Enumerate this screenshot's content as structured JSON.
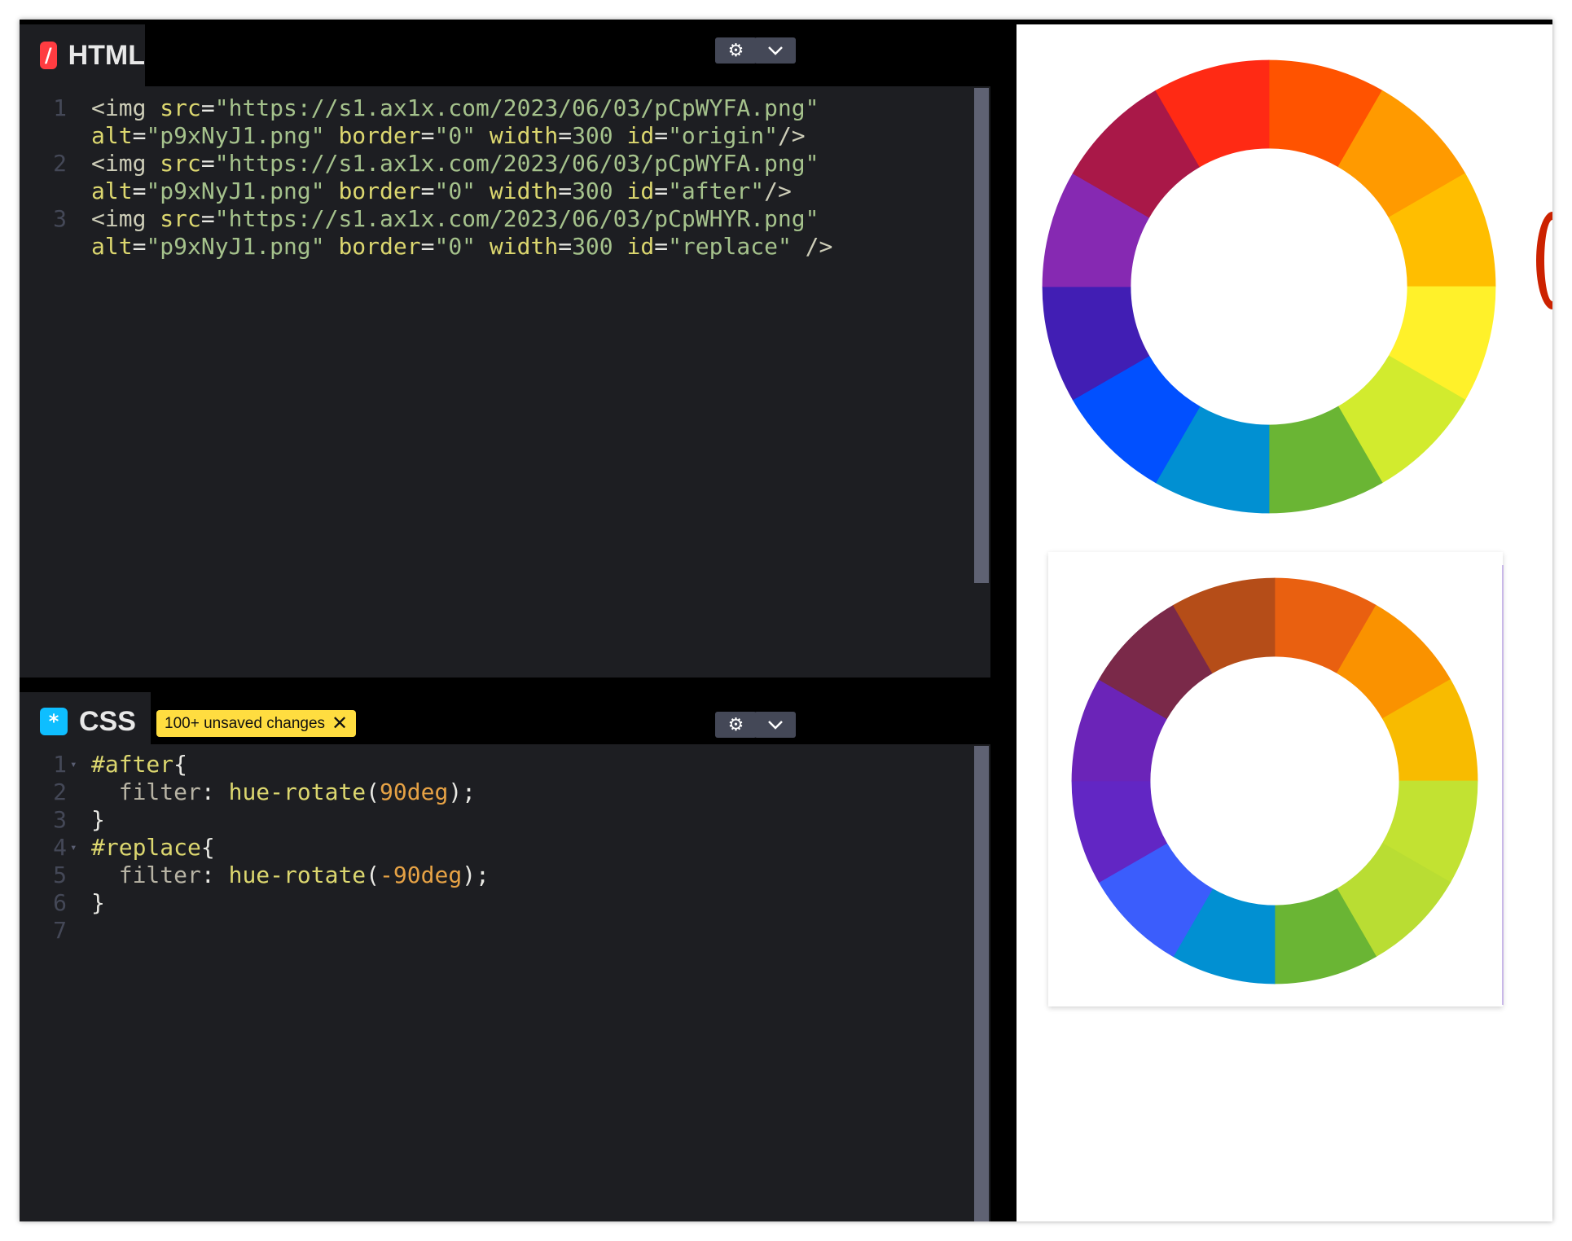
{
  "html_panel": {
    "title": "HTML",
    "icon": "codepen-html-icon",
    "icon_color": "#ff3c41",
    "settings_icon": "gear-icon",
    "collapse_icon": "chevron-down-icon",
    "lines": [
      {
        "number": "1",
        "rows": [
          [
            [
              "tag",
              "<img "
            ],
            [
              "attr",
              "src"
            ],
            [
              "pun",
              "="
            ],
            [
              "str",
              "\"https://s1.ax1x.com/2023/06/03/pCpWYFA.png\""
            ]
          ],
          [
            [
              "attr",
              "alt"
            ],
            [
              "pun",
              "="
            ],
            [
              "str",
              "\"p9xNyJ1.png\""
            ],
            [
              "pun",
              " "
            ],
            [
              "attr",
              "border"
            ],
            [
              "pun",
              "="
            ],
            [
              "str",
              "\"0\""
            ],
            [
              "pun",
              " "
            ],
            [
              "attr",
              "width"
            ],
            [
              "pun",
              "="
            ],
            [
              "str",
              "300"
            ],
            [
              "pun",
              " "
            ],
            [
              "attr",
              "id"
            ],
            [
              "pun",
              "="
            ],
            [
              "str",
              "\"origin\""
            ],
            [
              "tag",
              "/>"
            ]
          ]
        ]
      },
      {
        "number": "2",
        "rows": [
          [
            [
              "tag",
              "<img "
            ],
            [
              "attr",
              "src"
            ],
            [
              "pun",
              "="
            ],
            [
              "str",
              "\"https://s1.ax1x.com/2023/06/03/pCpWYFA.png\""
            ]
          ],
          [
            [
              "attr",
              "alt"
            ],
            [
              "pun",
              "="
            ],
            [
              "str",
              "\"p9xNyJ1.png\""
            ],
            [
              "pun",
              " "
            ],
            [
              "attr",
              "border"
            ],
            [
              "pun",
              "="
            ],
            [
              "str",
              "\"0\""
            ],
            [
              "pun",
              " "
            ],
            [
              "attr",
              "width"
            ],
            [
              "pun",
              "="
            ],
            [
              "str",
              "300"
            ],
            [
              "pun",
              " "
            ],
            [
              "attr",
              "id"
            ],
            [
              "pun",
              "="
            ],
            [
              "str",
              "\"after\""
            ],
            [
              "tag",
              "/>"
            ]
          ]
        ]
      },
      {
        "number": "3",
        "rows": [
          [
            [
              "tag",
              "<img "
            ],
            [
              "attr",
              "src"
            ],
            [
              "pun",
              "="
            ],
            [
              "str",
              "\"https://s1.ax1x.com/2023/06/03/pCpWHYR.png\""
            ]
          ],
          [
            [
              "attr",
              "alt"
            ],
            [
              "pun",
              "="
            ],
            [
              "str",
              "\"p9xNyJ1.png\""
            ],
            [
              "pun",
              " "
            ],
            [
              "attr",
              "border"
            ],
            [
              "pun",
              "="
            ],
            [
              "str",
              "\"0\""
            ],
            [
              "pun",
              " "
            ],
            [
              "attr",
              "width"
            ],
            [
              "pun",
              "="
            ],
            [
              "str",
              "300"
            ],
            [
              "pun",
              " "
            ],
            [
              "attr",
              "id"
            ],
            [
              "pun",
              "="
            ],
            [
              "str",
              "\"replace\""
            ],
            [
              "tag",
              " />"
            ]
          ]
        ]
      }
    ]
  },
  "css_panel": {
    "title": "CSS",
    "icon": "codepen-css-icon",
    "icon_color": "#0ebeff",
    "badge": "100+ unsaved changes",
    "badge_close_icon": "close-icon",
    "settings_icon": "gear-icon",
    "collapse_icon": "chevron-down-icon",
    "lines": [
      {
        "number": "1",
        "fold": true,
        "tokens": [
          [
            "sel",
            "#after"
          ],
          [
            "pun",
            "{"
          ]
        ]
      },
      {
        "number": "2",
        "fold": false,
        "tokens": [
          [
            "pun",
            "  "
          ],
          [
            "prop",
            "filter"
          ],
          [
            "pun",
            ": "
          ],
          [
            "fn",
            "hue-rotate"
          ],
          [
            "pun",
            "("
          ],
          [
            "num",
            "90deg"
          ],
          [
            "pun",
            ");"
          ]
        ]
      },
      {
        "number": "3",
        "fold": false,
        "tokens": [
          [
            "pun",
            "}"
          ]
        ]
      },
      {
        "number": "4",
        "fold": true,
        "tokens": [
          [
            "sel",
            "#replace"
          ],
          [
            "pun",
            "{"
          ]
        ]
      },
      {
        "number": "5",
        "fold": false,
        "tokens": [
          [
            "pun",
            "  "
          ],
          [
            "prop",
            "filter"
          ],
          [
            "pun",
            ": "
          ],
          [
            "fn",
            "hue-rotate"
          ],
          [
            "pun",
            "("
          ],
          [
            "num",
            "-90deg"
          ],
          [
            "pun",
            ");"
          ]
        ]
      },
      {
        "number": "6",
        "fold": false,
        "tokens": [
          [
            "pun",
            "}"
          ]
        ]
      },
      {
        "number": "7",
        "fold": false,
        "tokens": []
      }
    ]
  },
  "preview": {
    "images": [
      {
        "id": "origin",
        "colors": [
          "#ff5300",
          "#ff9a00",
          "#ffbe00",
          "#fff12a",
          "#d2eb2e",
          "#6ab534",
          "#0190d2",
          "#0150ff",
          "#411eb4",
          "#8629b2",
          "#a91848",
          "#ff2a14"
        ]
      },
      {
        "id": "replace",
        "colors": [
          "#e96010",
          "#fa9200",
          "#f8bb00",
          "#c2e232",
          "#b9dd33",
          "#6ab534",
          "#0190d2",
          "#3b5dfc",
          "#6226c4",
          "#6b24b8",
          "#7a2949",
          "#b54d18"
        ]
      }
    ]
  }
}
